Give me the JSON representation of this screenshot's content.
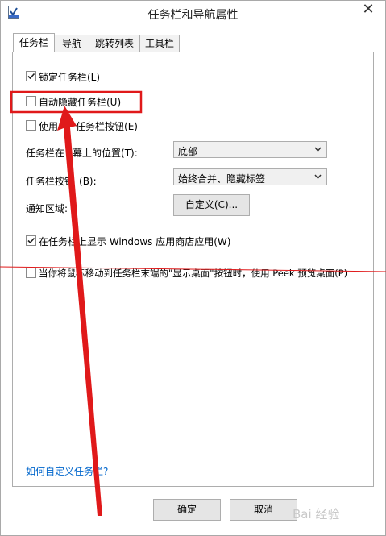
{
  "window": {
    "title": "任务栏和导航属性",
    "close_glyph": "✕"
  },
  "tabs": [
    {
      "label": "任务栏",
      "active": true
    },
    {
      "label": "导航",
      "active": false
    },
    {
      "label": "跳转列表",
      "active": false
    },
    {
      "label": "工具栏",
      "active": false
    }
  ],
  "options": {
    "lock_taskbar": {
      "label": "锁定任务栏(L)",
      "checked": true
    },
    "auto_hide": {
      "label": "自动隐藏任务栏(U)",
      "checked": false
    },
    "small_buttons": {
      "label_before": "使用",
      "label_after": "任务栏按钮(E)",
      "checked": false
    },
    "position": {
      "label_before": "任务栏在",
      "label_after": "幕上的位置(T):",
      "value": "底部"
    },
    "buttons": {
      "label_before": "任务栏按钮",
      "label_after": "(B):",
      "value": "始终合并、隐藏标签"
    },
    "notification": {
      "label": "通知区域:",
      "button": "自定义(C)..."
    },
    "show_store_apps": {
      "label": "在任务栏上显示 Windows 应用商店应用(W)",
      "checked": true
    },
    "peek": {
      "label": "当你将鼠标移动到任务栏末端的\"显示桌面\"按钮时，使用 Peek 预览桌面(P)",
      "checked": false
    }
  },
  "help_link": "如何自定义任务栏?",
  "footer": {
    "ok": "确定",
    "cancel": "取消"
  },
  "annotation_color": "#e0191a",
  "watermark": "Bai 经验"
}
